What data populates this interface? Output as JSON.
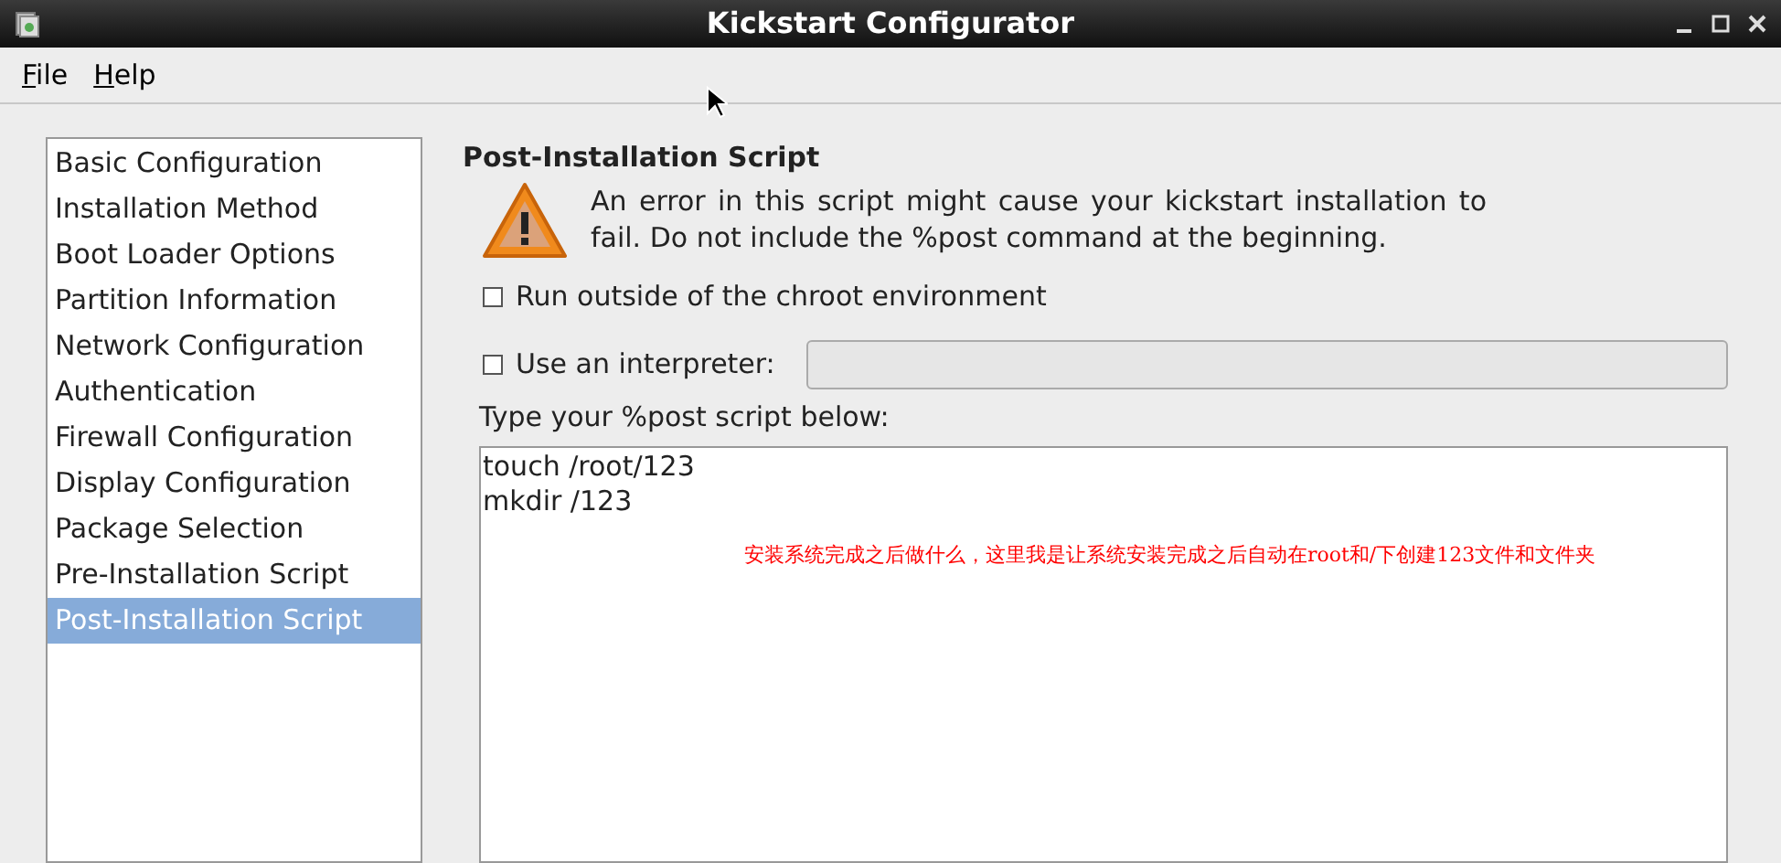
{
  "window": {
    "title": "Kickstart Configurator"
  },
  "menu": [
    {
      "label": "File"
    },
    {
      "label": "Help"
    }
  ],
  "sidebar": {
    "items": [
      {
        "label": "Basic Configuration",
        "selected": false
      },
      {
        "label": "Installation Method",
        "selected": false
      },
      {
        "label": "Boot Loader Options",
        "selected": false
      },
      {
        "label": "Partition Information",
        "selected": false
      },
      {
        "label": "Network Configuration",
        "selected": false
      },
      {
        "label": "Authentication",
        "selected": false
      },
      {
        "label": "Firewall Configuration",
        "selected": false
      },
      {
        "label": "Display Configuration",
        "selected": false
      },
      {
        "label": "Package Selection",
        "selected": false
      },
      {
        "label": "Pre-Installation Script",
        "selected": false
      },
      {
        "label": "Post-Installation Script",
        "selected": true
      }
    ]
  },
  "panel": {
    "heading": "Post-Installation Script",
    "warning": "An error in this script might cause your kickstart installation to fail. Do not include the %post command at the beginning.",
    "options": [
      {
        "label": "Run outside of the chroot environment",
        "checked": false,
        "kind": "checkbox"
      },
      {
        "label": "Use an interpreter:",
        "checked": false,
        "kind": "checkbox-field"
      }
    ],
    "script_label": "Type your %post script below:",
    "script_lines": [
      "touch /root/123",
      "mkdir /123"
    ],
    "annotation": "安装系统完成之后做什么，这里我是让系统安装完成之后自动在root和/下创建123文件和文件夹"
  }
}
